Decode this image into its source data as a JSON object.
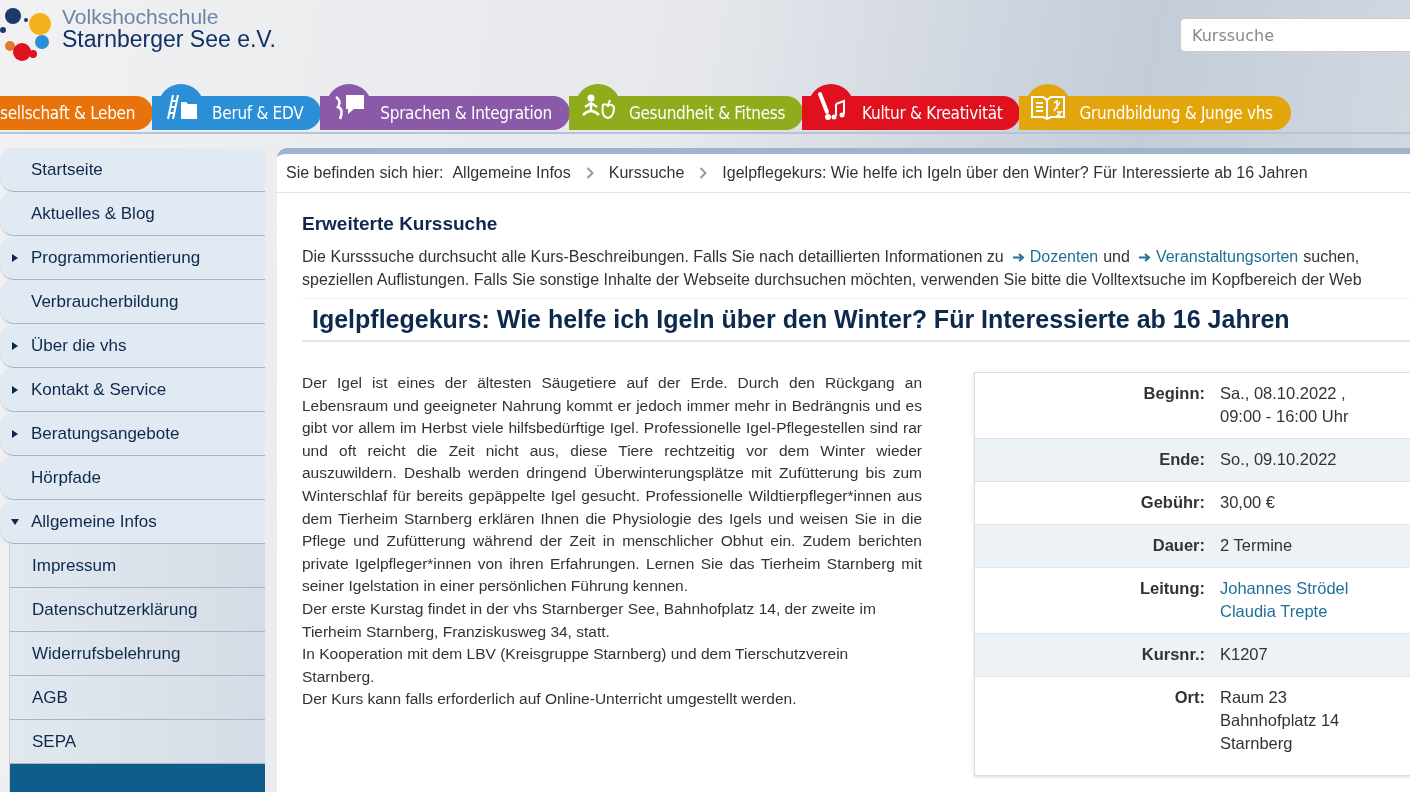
{
  "logo": {
    "line_1": "Volkshochschule",
    "line_2": "Starnberger See e.V."
  },
  "search": {
    "placeholder": "Kurssuche"
  },
  "categories": [
    {
      "label": "sellschaft & Leben",
      "color": "#e8720c"
    },
    {
      "label": "Beruf & EDV",
      "color": "#2a8fd6"
    },
    {
      "label": "Sprachen & Integration",
      "color": "#8a5aa8"
    },
    {
      "label": "Gesundheit & Fitness",
      "color": "#8fac1c"
    },
    {
      "label": "Kultur & Kreativität",
      "color": "#e0101e"
    },
    {
      "label": "Grundbildung & Junge vhs",
      "color": "#e3a50c"
    }
  ],
  "sidebar": {
    "items": [
      {
        "label": "Startseite",
        "selected": false
      },
      {
        "label": "Aktuelles & Blog",
        "selected": false
      },
      {
        "label": "Programmorientierung",
        "expanded": false,
        "selected": false
      },
      {
        "label": "Verbraucherbildung",
        "selected": false
      },
      {
        "label": "Über die vhs",
        "expanded": false,
        "selected": false
      },
      {
        "label": "Kontakt & Service",
        "expanded": false,
        "selected": false
      },
      {
        "label": "Beratungsangebote",
        "expanded": false,
        "selected": false
      },
      {
        "label": "Hörpfade",
        "selected": false
      },
      {
        "label": "Allgemeine Infos",
        "expanded": true,
        "selected": false,
        "children": [
          {
            "label": "Impressum",
            "selected": false
          },
          {
            "label": "Datenschutzerklärung",
            "selected": false
          },
          {
            "label": "Widerrufsbelehrung",
            "selected": false
          },
          {
            "label": "AGB",
            "selected": false
          },
          {
            "label": "SEPA",
            "selected": false
          },
          {
            "selected": true
          }
        ]
      }
    ]
  },
  "breadcrumb": {
    "prefix": "Sie befinden sich hier:",
    "items": [
      "Allgemeine Infos",
      "Kurssuche",
      "Igelpflegekurs: Wie helfe ich Igeln über den Winter? Für Interessierte ab 16 Jahren"
    ]
  },
  "search_info": {
    "title": "Erweiterte Kurssuche",
    "line_1": [
      {
        "kind": "text",
        "text": "Die Kursssuche durchsucht alle Kurs-Beschreibungen. Falls Sie nach detaillierten Informationen zu"
      },
      {
        "kind": "link",
        "text": "Dozenten"
      },
      {
        "kind": "text",
        "text": "und"
      },
      {
        "kind": "link",
        "text": "Veranstaltungsorten"
      },
      {
        "kind": "text",
        "text": "suchen,"
      }
    ],
    "line_2": "speziellen Auflistungen. Falls Sie sonstige Inhalte der Webseite durchsuchen möchten, verwenden Sie bitte die Volltextsuche im Kopfbereich der Web"
  },
  "course": {
    "title": "Igelpflegekurs: Wie helfe ich Igeln über den Winter? Für Interessierte ab 16 Jahren",
    "description": [
      "Der Igel ist eines der ältesten Säugetiere auf der Erde. Durch den Rückgang an Lebensraum und geeigneter Nahrung kommt er jedoch immer mehr in Bedrängnis und es gibt vor allem im Herbst viele hilfsbedürftige Igel. Professionelle Igel-Pflegestellen sind rar und oft reicht die Zeit nicht aus, diese Tiere rechtzeitig vor dem Winter wieder auszuwildern. Deshalb werden dringend Überwinterungsplätze mit Zufütterung bis zum Winterschlaf für bereits gepäppelte Igel gesucht. Professionelle Wildtierpfleger*innen aus dem Tierheim Starnberg erklären Ihnen die Physiologie des Igels und weisen Sie in die Pflege und Zufütterung während der Zeit in menschlicher Obhut ein. Zudem berichten private Igelpfleger*innen von ihren Erfahrungen. Lernen Sie das Tierheim Starnberg mit seiner Igelstation in einer persönlichen Führung kennen.",
      "Der erste Kurstag findet in der vhs Starnberger See, Bahnhofplatz 14, der zweite im Tierheim Starnberg, Franziskusweg 34, statt.",
      "In Kooperation mit dem LBV (Kreisgruppe Starnberg) und dem Tierschutzverein Starnberg.",
      "Der Kurs kann falls erforderlich auf Online-Unterricht umgestellt werden."
    ],
    "details": [
      {
        "label": "Beginn:",
        "kind": "text",
        "lines": [
          "Sa., 08.10.2022 ,",
          "09:00 - 16:00 Uhr"
        ]
      },
      {
        "label": "Ende:",
        "kind": "text",
        "lines": [
          "So., 09.10.2022"
        ]
      },
      {
        "label": "Gebühr:",
        "kind": "text",
        "lines": [
          "30,00 €"
        ]
      },
      {
        "label": "Dauer:",
        "kind": "text",
        "lines": [
          "2 Termine"
        ]
      },
      {
        "label": "Leitung:",
        "kind": "link",
        "lines": [
          "Johannes Strödel",
          "Claudia Trepte"
        ]
      },
      {
        "label": "Kursnr.:",
        "kind": "text",
        "lines": [
          "K1207"
        ]
      },
      {
        "label": "Ort:",
        "kind": "text",
        "lines": [
          "Raum 23",
          "Bahnhofplatz 14",
          "Starnberg"
        ]
      }
    ]
  }
}
